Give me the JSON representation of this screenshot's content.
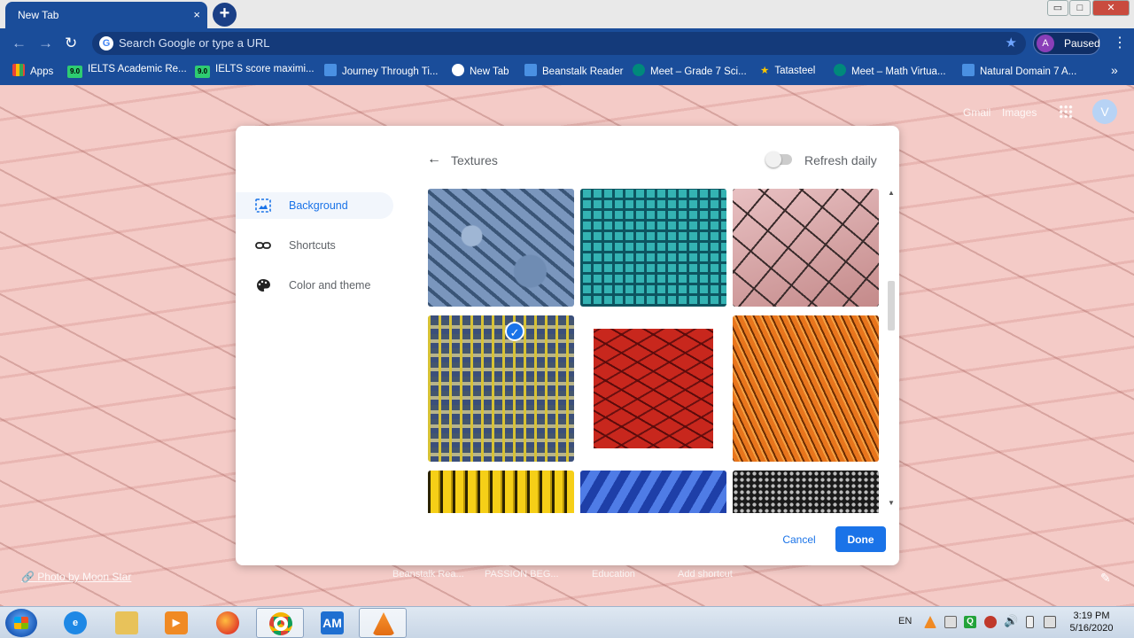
{
  "browser": {
    "tab_title": "New Tab",
    "tab_close": "×",
    "new_tab": "+",
    "omnibox_placeholder": "Search Google or type a URL",
    "profile_initial": "A",
    "profile_status": "Paused",
    "window_controls": [
      "▭",
      "□",
      "✕"
    ]
  },
  "bookmarks": [
    {
      "label": "Apps",
      "color": "#4285f4"
    },
    {
      "label": "IELTS Academic Re...",
      "color": "#2ecc71",
      "badge": "9.0"
    },
    {
      "label": "IELTS score maximi...",
      "color": "#2ecc71",
      "badge": "9.0"
    },
    {
      "label": "Journey Through Ti...",
      "color": "#4a90e2"
    },
    {
      "label": "New Tab",
      "color": "#ffffff"
    },
    {
      "label": "Beanstalk Reader",
      "color": "#4a90e2"
    },
    {
      "label": "Meet – Grade 7 Sci...",
      "color": "#00897b"
    },
    {
      "label": "Tatasteel",
      "color": "#f9c600"
    },
    {
      "label": "Meet – Math Virtua...",
      "color": "#00897b"
    },
    {
      "label": "Natural Domain 7 A...",
      "color": "#4a90e2"
    }
  ],
  "ntp": {
    "gmail": "Gmail",
    "images": "Images",
    "avatar_initial": "V",
    "photo_credit": "Photo by Moon Star",
    "shortcuts": [
      "Beanstalk Rea...",
      "PASSION BEG...",
      "Education",
      "Add shortcut"
    ]
  },
  "dialog": {
    "sidebar": [
      {
        "label": "Background",
        "icon": "image-icon",
        "active": true
      },
      {
        "label": "Shortcuts",
        "icon": "link-icon",
        "active": false
      },
      {
        "label": "Color and theme",
        "icon": "palette-icon",
        "active": false
      }
    ],
    "title": "Textures",
    "refresh_label": "Refresh daily",
    "refresh_on": false,
    "cancel": "Cancel",
    "done": "Done",
    "selected_index": 4,
    "accent": "#1a73e8"
  },
  "taskbar": {
    "lang": "EN",
    "time": "3:19 PM",
    "date": "5/16/2020",
    "am_label": "AM"
  }
}
